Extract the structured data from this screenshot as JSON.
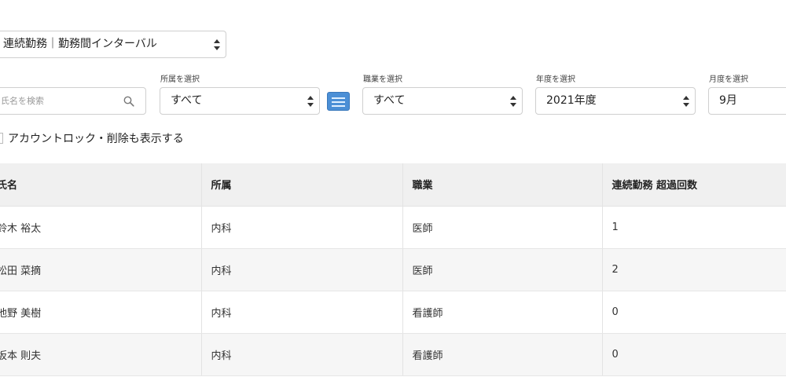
{
  "report_select": {
    "value": "連続勤務｜勤務間インターバル"
  },
  "filters": {
    "search": {
      "placeholder": "氏名を検索"
    },
    "department": {
      "label": "所属を選択",
      "value": "すべて"
    },
    "occupation": {
      "label": "職業を選択",
      "value": "すべて"
    },
    "year": {
      "label": "年度を選択",
      "value": "2021年度"
    },
    "month": {
      "label": "月度を選択",
      "value": "9月"
    }
  },
  "show_locked_label": "アカウントロック・削除も表示する",
  "table": {
    "headers": [
      "氏名",
      "所属",
      "職業",
      "連続勤務 超過回数"
    ],
    "rows": [
      [
        "鈴木 裕太",
        "内科",
        "医師",
        "1"
      ],
      [
        "松田 菜摘",
        "内科",
        "医師",
        "2"
      ],
      [
        "池野 美樹",
        "内科",
        "看護師",
        "0"
      ],
      [
        "坂本 則夫",
        "内科",
        "看護師",
        "0"
      ]
    ]
  },
  "icons": {
    "search": "search-icon",
    "list": "list-icon",
    "select_arrows": "chevron-updown-icon"
  },
  "colors": {
    "accent": "#4b8fd6",
    "header_bg": "#f0f0f0",
    "stripe": "#f6f6f6"
  }
}
